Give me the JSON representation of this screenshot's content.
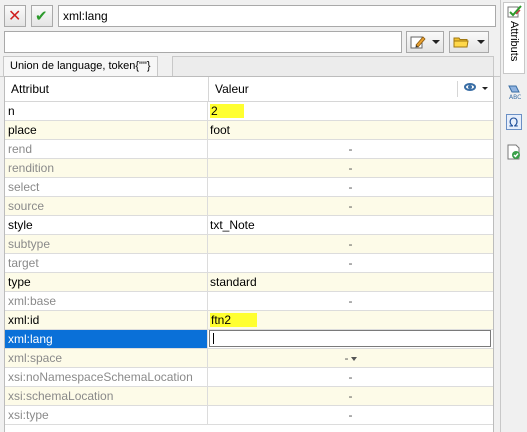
{
  "toolbar": {
    "cancel_icon": "x-icon",
    "accept_icon": "check-icon",
    "attribute_name": "xml:lang",
    "attribute_value": ""
  },
  "type_tab": {
    "label": "Union de language, token{\"\"}"
  },
  "table": {
    "header_attr": "Attribut",
    "header_value": "Valeur",
    "rows": [
      {
        "name": "n",
        "value": "2",
        "kind": "set",
        "highlight": true
      },
      {
        "name": "place",
        "value": "foot",
        "kind": "set"
      },
      {
        "name": "rend",
        "value": "-",
        "kind": "unset"
      },
      {
        "name": "rendition",
        "value": "-",
        "kind": "unset"
      },
      {
        "name": "select",
        "value": "-",
        "kind": "unset"
      },
      {
        "name": "source",
        "value": "-",
        "kind": "unset"
      },
      {
        "name": "style",
        "value": "txt_Note",
        "kind": "set"
      },
      {
        "name": "subtype",
        "value": "-",
        "kind": "unset"
      },
      {
        "name": "target",
        "value": "-",
        "kind": "unset"
      },
      {
        "name": "type",
        "value": "standard",
        "kind": "set"
      },
      {
        "name": "xml:base",
        "value": "-",
        "kind": "unset"
      },
      {
        "name": "xml:id",
        "value": "ftn2",
        "kind": "set",
        "highlight": true
      },
      {
        "name": "xml:lang",
        "value": "",
        "kind": "editing",
        "selected": true
      },
      {
        "name": "xml:space",
        "value": "-",
        "kind": "unset",
        "dropdown": true
      },
      {
        "name": "xsi:noNamespaceSchemaLocation",
        "value": "-",
        "kind": "unset"
      },
      {
        "name": "xsi:schemaLocation",
        "value": "-",
        "kind": "unset"
      },
      {
        "name": "xsi:type",
        "value": "-",
        "kind": "unset"
      }
    ]
  },
  "side": {
    "attributes_tab": "Attributs"
  },
  "colors": {
    "highlight": "#ffff30",
    "selection": "#0a70d8",
    "row_alt": "#fdfbe8"
  }
}
